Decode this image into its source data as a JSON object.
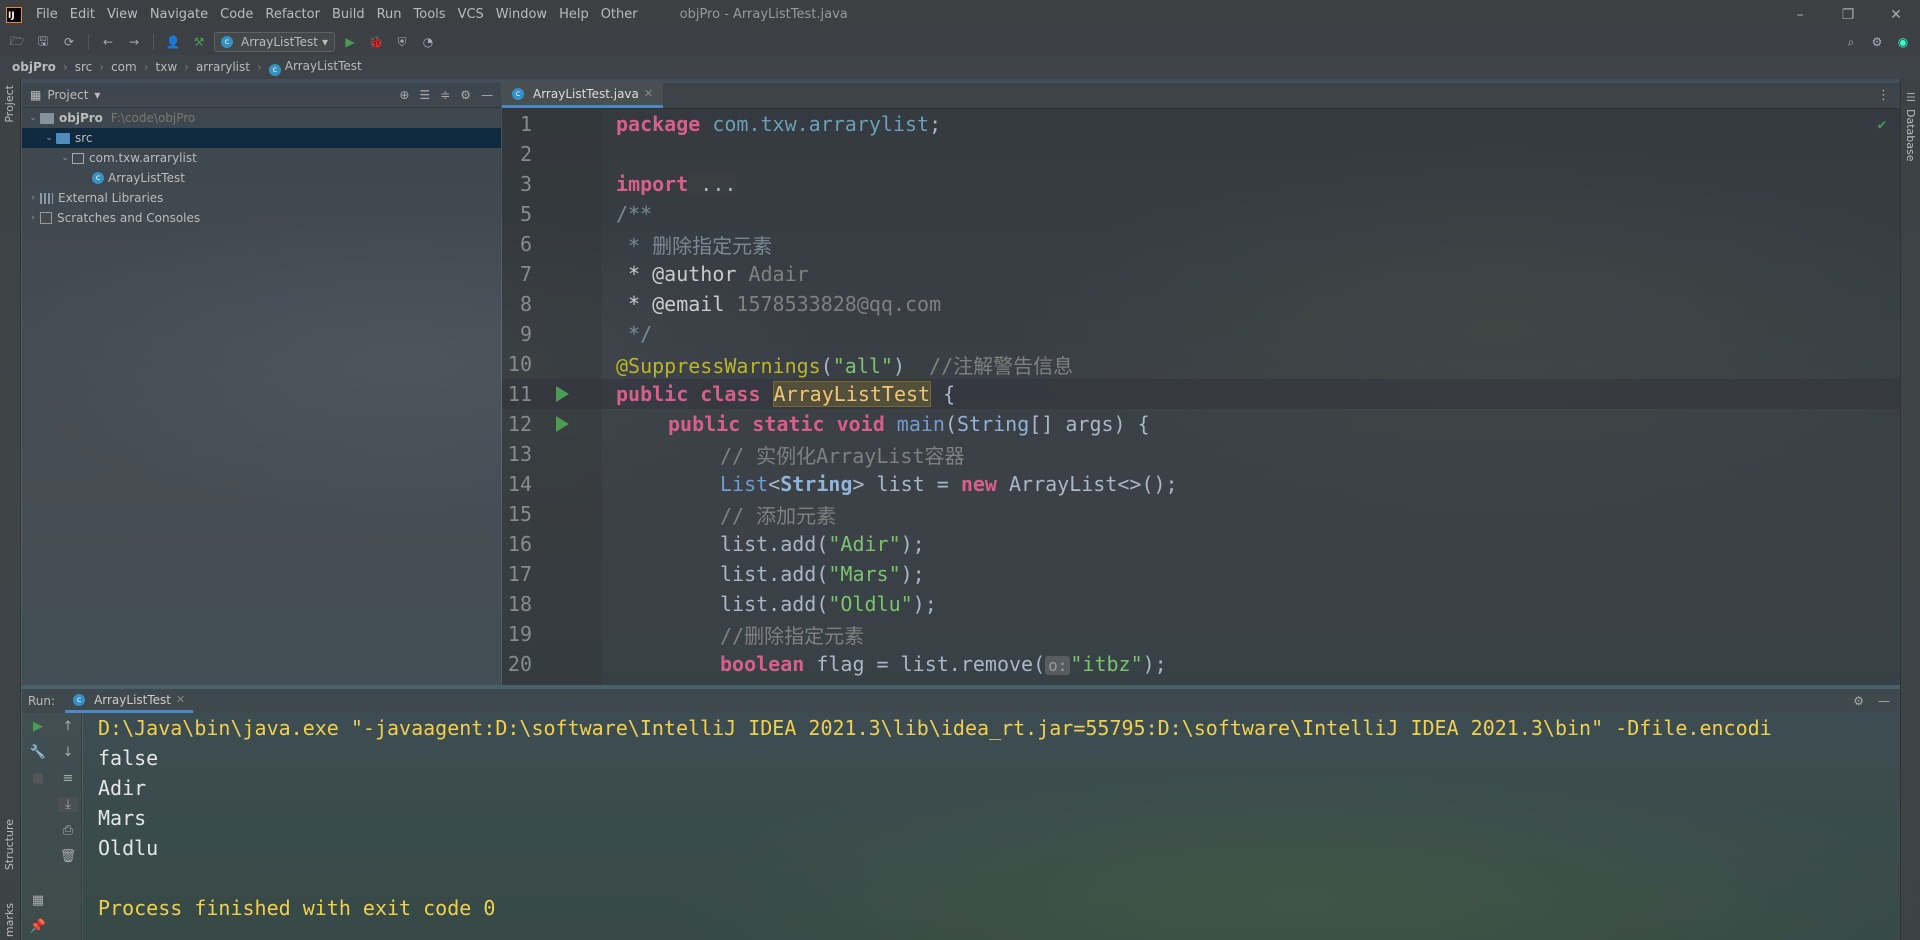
{
  "titlebar": {
    "app_logo": "IJ",
    "menu": [
      "File",
      "Edit",
      "View",
      "Navigate",
      "Code",
      "Refactor",
      "Build",
      "Run",
      "Tools",
      "VCS",
      "Window",
      "Help",
      "Other"
    ],
    "window_title": "objPro - ArrayListTest.java",
    "controls": [
      "–",
      "❐",
      "✕"
    ]
  },
  "toolbar": {
    "run_config": "ArrayListTest"
  },
  "breadcrumb": [
    "objPro",
    "src",
    "com",
    "txw",
    "arrarylist",
    "ArrayListTest"
  ],
  "left_stripe": {
    "project_label": "Project",
    "structure_label": "Structure",
    "bookmarks_label": "marks"
  },
  "right_stripe": {
    "database_label": "Database"
  },
  "project_panel": {
    "title": "Project",
    "tree": [
      {
        "label": "objPro",
        "path": "F:\\code\\objPro",
        "icon": "folder-icon"
      },
      {
        "label": "src",
        "icon": "source-folder-icon"
      },
      {
        "label": "com.txw.arrarylist",
        "icon": "package-icon"
      },
      {
        "label": "ArrayListTest",
        "icon": "java-class-icon"
      },
      {
        "label": "External Libraries",
        "icon": "library-icon"
      },
      {
        "label": "Scratches and Consoles",
        "icon": "scratch-icon"
      }
    ]
  },
  "editor": {
    "tab_label": "ArrayListTest.java",
    "line_numbers": [
      "1",
      "2",
      "3",
      "5",
      "6",
      "7",
      "8",
      "9",
      "10",
      "11",
      "12",
      "13",
      "14",
      "15",
      "16",
      "17",
      "18",
      "19",
      "20"
    ],
    "lines": {
      "l1_kw": "package",
      "l1_pkg": "com.txw.arrarylist",
      "l1_end": ";",
      "l3_kw": "import",
      "l3_rest": " ...",
      "l5": "/**",
      "l6": " * 删除指定元素",
      "l7_tag": " * @author",
      "l7_val": " Adair",
      "l8_tag": " * @email",
      "l8_val": " 1578533828@qq.com",
      "l9": " */",
      "l10_ann": "@SuppressWarnings",
      "l10_open": "(",
      "l10_str": "\"all\"",
      "l10_close": ")",
      "l10_cmt": "  //注解警告信息",
      "l11_kw": "public class",
      "l11_sp": " ",
      "l11_cls": "ArrayListTest",
      "l11_end": " {",
      "l12_kw": "public static void",
      "l12_fn": " main",
      "l12_open": "(",
      "l12_ty": "String",
      "l12_rest": "[] args) {",
      "l13": "// 实例化ArrayList容器",
      "l14_ty": "List",
      "l14_lt": "<",
      "l14_ty2": "String",
      "l14_mid": "> list = ",
      "l14_kw": "new",
      "l14_rest": " ArrayList<>();",
      "l15": "// 添加元素",
      "l16_a": "list.add(",
      "l16_s": "\"Adir\"",
      "l16_b": ");",
      "l17_a": "list.add(",
      "l17_s": "\"Mars\"",
      "l17_b": ");",
      "l18_a": "list.add(",
      "l18_s": "\"Oldlu\"",
      "l18_b": ");",
      "l19": "//删除指定元素",
      "l20_kw": "boolean",
      "l20_mid": " flag = list.remove(",
      "l20_hint": "o:",
      "l20_s": "\"itbz\"",
      "l20_end": ");"
    }
  },
  "run_panel": {
    "label": "Run:",
    "tab_label": "ArrayListTest",
    "console": [
      "D:\\Java\\bin\\java.exe \"-javaagent:D:\\software\\IntelliJ IDEA 2021.3\\lib\\idea_rt.jar=55795:D:\\software\\IntelliJ IDEA 2021.3\\bin\" -Dfile.encodi",
      "false",
      "Adir",
      "Mars",
      "Oldlu",
      "",
      "Process finished with exit code 0"
    ]
  },
  "colors": {
    "keyword": "#cc7832",
    "string": "#6a8759",
    "comment": "#808080",
    "selection": "#0d293e",
    "run_green": "#499c54",
    "console_highlight": "#f0d050"
  }
}
